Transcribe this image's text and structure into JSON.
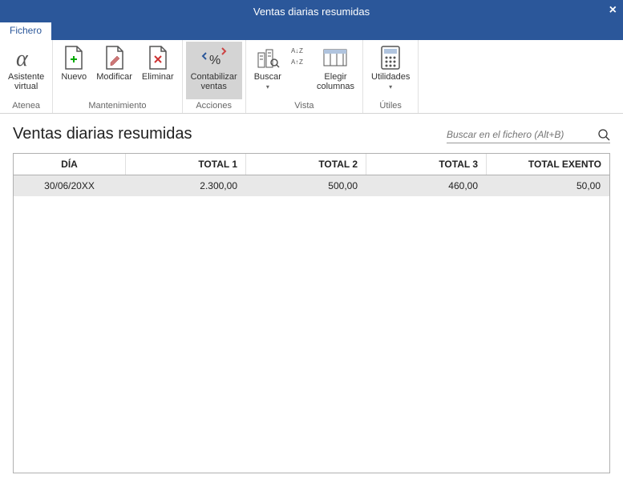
{
  "window": {
    "title": "Ventas diarias resumidas"
  },
  "tabs": {
    "file": "Fichero"
  },
  "ribbon": {
    "asistente": {
      "line1": "Asistente",
      "line2": "virtual"
    },
    "nuevo": "Nuevo",
    "modificar": "Modificar",
    "eliminar": "Eliminar",
    "contabilizar": {
      "line1": "Contabilizar",
      "line2": "ventas"
    },
    "buscar": "Buscar",
    "az": "",
    "elegir": {
      "line1": "Elegir",
      "line2": "columnas"
    },
    "utilidades": "Utilidades",
    "groups": {
      "atenea": "Atenea",
      "mantenimiento": "Mantenimiento",
      "acciones": "Acciones",
      "vista": "Vista",
      "utiles": "Útiles"
    }
  },
  "page": {
    "title": "Ventas diarias resumidas",
    "search_placeholder": "Buscar en el fichero (Alt+B)"
  },
  "table": {
    "headers": {
      "dia": "DÍA",
      "total1": "TOTAL 1",
      "total2": "TOTAL 2",
      "total3": "TOTAL 3",
      "exento": "TOTAL EXENTO"
    },
    "rows": [
      {
        "dia": "30/06/20XX",
        "total1": "2.300,00",
        "total2": "500,00",
        "total3": "460,00",
        "exento": "50,00"
      }
    ]
  }
}
